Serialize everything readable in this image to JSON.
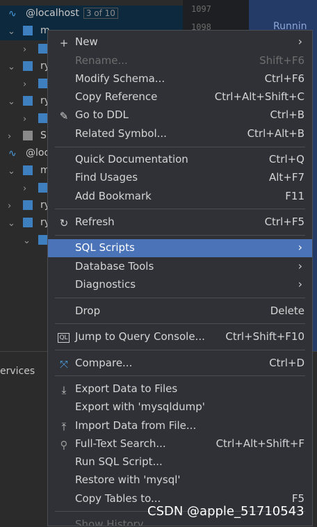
{
  "tree": {
    "rows": [
      {
        "label": "@localhost",
        "badge": "3 of 10"
      },
      {
        "label": "m"
      },
      {
        "label": ""
      },
      {
        "label": "ry"
      },
      {
        "label": ""
      },
      {
        "label": "ry"
      },
      {
        "label": ""
      },
      {
        "label": "S"
      },
      {
        "label": "@loc"
      },
      {
        "label": "m"
      },
      {
        "label": ""
      },
      {
        "label": "ry"
      },
      {
        "label": "ry"
      }
    ]
  },
  "editor": {
    "line1": "1097",
    "line2": "1098",
    "stripe_text": "Runnin"
  },
  "services": {
    "title": "ervices"
  },
  "menu": {
    "items": [
      {
        "label": "New",
        "shortcut": "",
        "icon": "plus-icon",
        "submenu": true
      },
      {
        "label": "Rename...",
        "shortcut": "Shift+F6",
        "disabled": true
      },
      {
        "label": "Modify Schema...",
        "shortcut": "Ctrl+F6"
      },
      {
        "label": "Copy Reference",
        "shortcut": "Ctrl+Alt+Shift+C"
      },
      {
        "label": "Go to DDL",
        "shortcut": "Ctrl+B",
        "icon": "pencil-icon"
      },
      {
        "label": "Related Symbol...",
        "shortcut": "Ctrl+Alt+B"
      },
      {
        "label": "Quick Documentation",
        "shortcut": "Ctrl+Q"
      },
      {
        "label": "Find Usages",
        "shortcut": "Alt+F7"
      },
      {
        "label": "Add Bookmark",
        "shortcut": "F11"
      },
      {
        "label": "Refresh",
        "shortcut": "Ctrl+F5",
        "icon": "refresh-icon"
      },
      {
        "label": "SQL Scripts",
        "shortcut": "",
        "submenu": true,
        "active": true
      },
      {
        "label": "Database Tools",
        "shortcut": "",
        "submenu": true
      },
      {
        "label": "Diagnostics",
        "shortcut": "",
        "submenu": true
      },
      {
        "label": "Drop",
        "shortcut": "Delete"
      },
      {
        "label": "Jump to Query Console...",
        "shortcut": "Ctrl+Shift+F10",
        "icon": "console-icon"
      },
      {
        "label": "Compare...",
        "shortcut": "Ctrl+D",
        "icon": "compare-icon"
      },
      {
        "label": "Export Data to Files",
        "shortcut": "",
        "icon": "export-icon"
      },
      {
        "label": "Export with 'mysqldump'",
        "shortcut": ""
      },
      {
        "label": "Import Data from File...",
        "shortcut": "",
        "icon": "import-icon"
      },
      {
        "label": "Full-Text Search...",
        "shortcut": "Ctrl+Alt+Shift+F",
        "icon": "search-icon"
      },
      {
        "label": "Run SQL Script...",
        "shortcut": ""
      },
      {
        "label": "Restore with 'mysql'",
        "shortcut": ""
      },
      {
        "label": "Copy Tables to...",
        "shortcut": "F5"
      },
      {
        "label": "Show History",
        "shortcut": "",
        "disabled": true
      }
    ]
  },
  "watermark": "CSDN @apple_51710543",
  "colors": {
    "menu_bg": "#2f3136",
    "active": "#4a73b8",
    "tree_selected": "#0d293e"
  }
}
